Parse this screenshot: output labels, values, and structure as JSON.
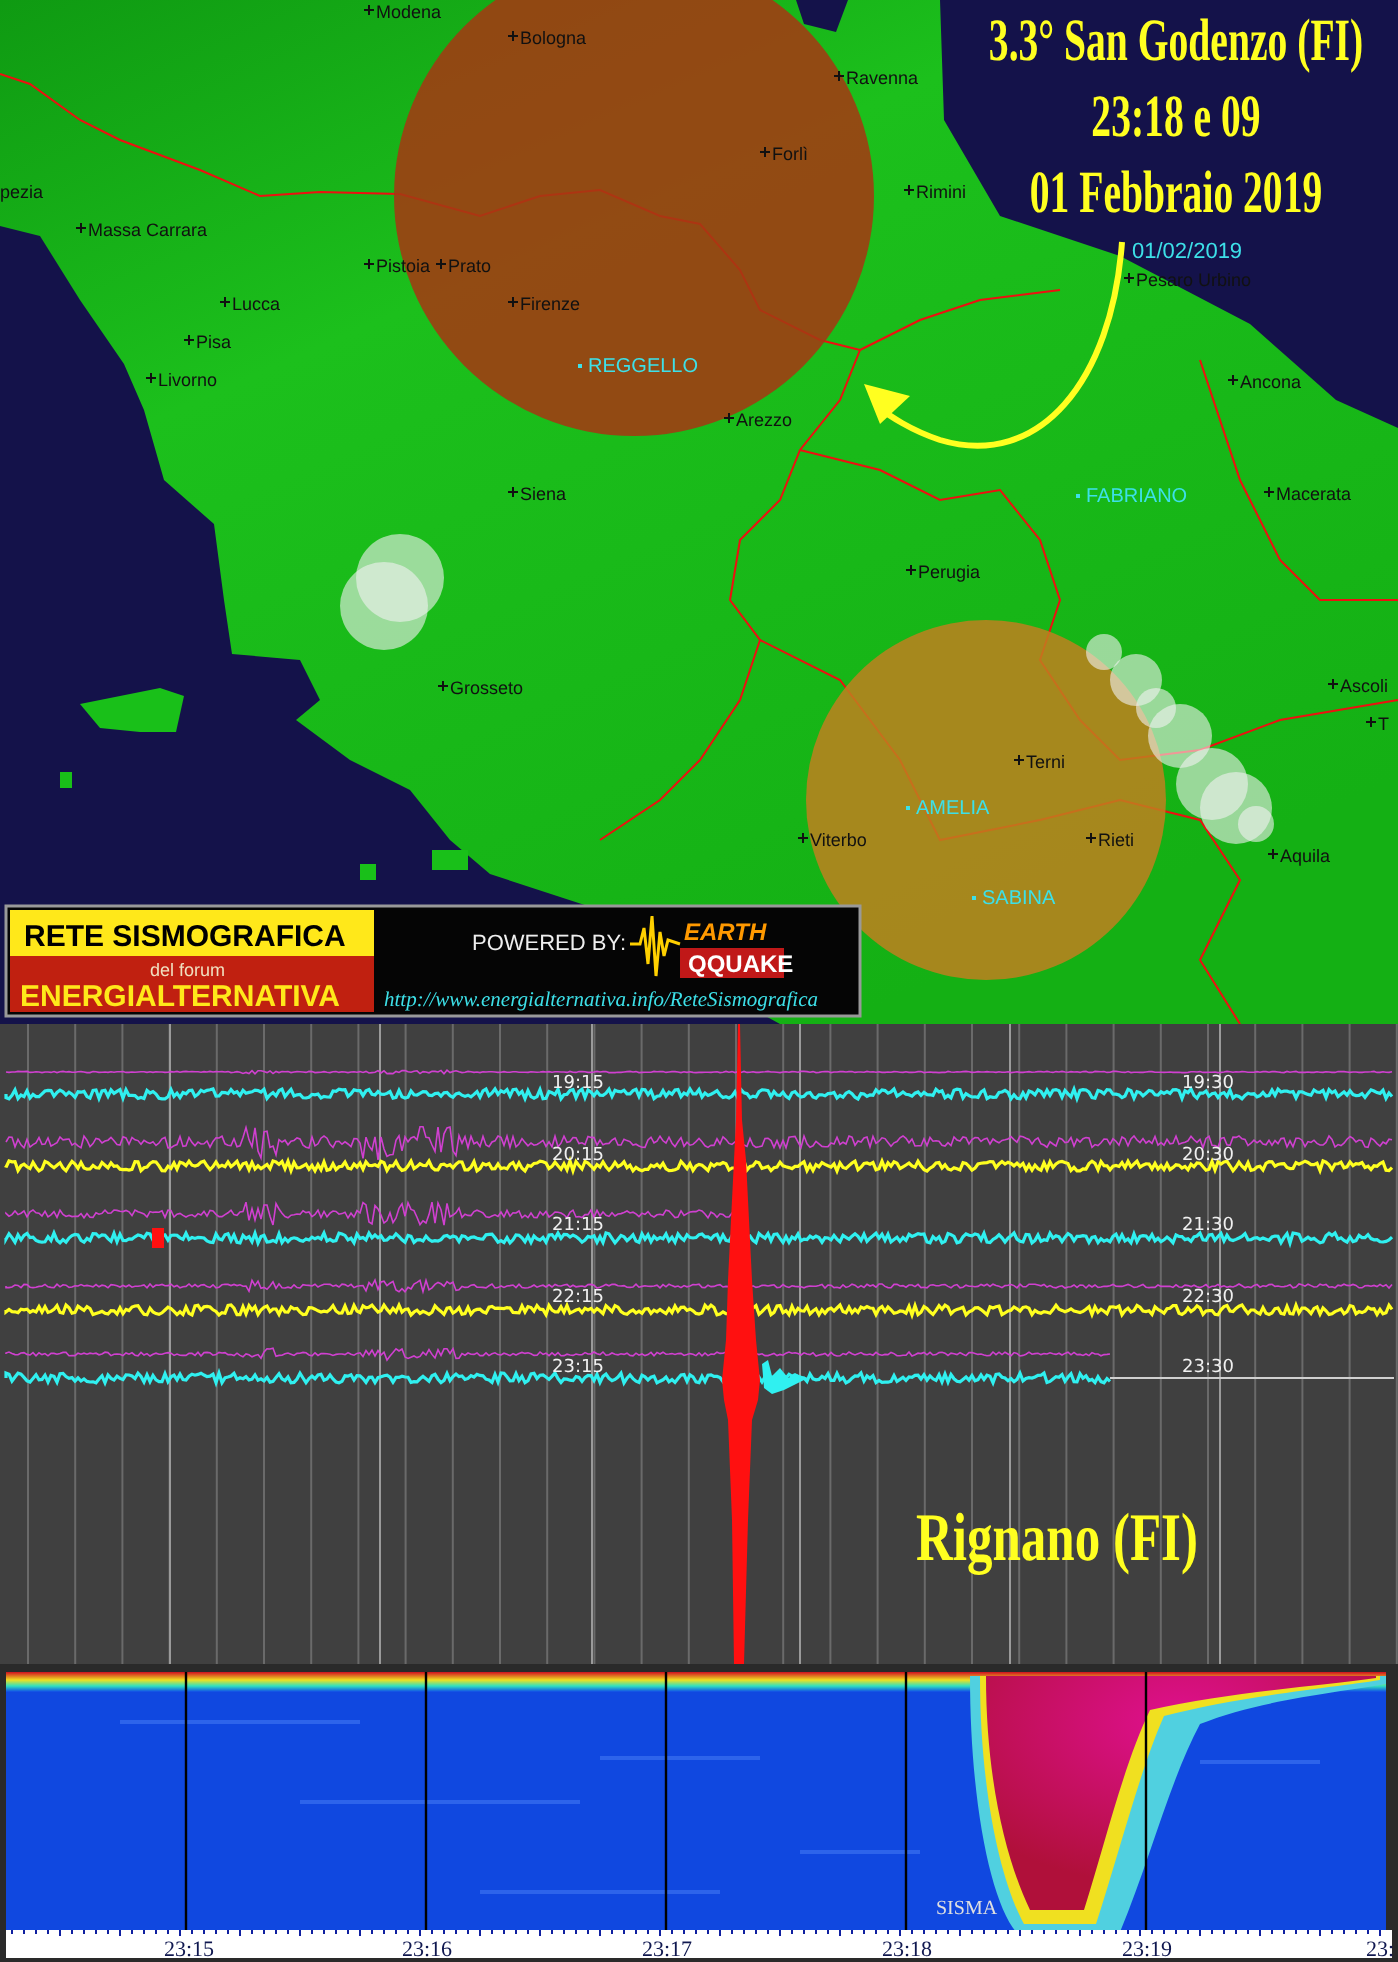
{
  "map": {
    "headline": [
      "3.3° San Godenzo (FI)",
      "23:18 e 09",
      "01 Febbraio 2019"
    ],
    "date_label": "01/02/2019",
    "cities": [
      {
        "name": "Modena"
      },
      {
        "name": "Bologna"
      },
      {
        "name": "Ravenna"
      },
      {
        "name": "Forlì"
      },
      {
        "name": "Rimini"
      },
      {
        "name": "Pesaro Urbino"
      },
      {
        "name": "pezia"
      },
      {
        "name": "Massa Carrara"
      },
      {
        "name": "Pistoia"
      },
      {
        "name": "Prato"
      },
      {
        "name": "Firenze"
      },
      {
        "name": "Lucca"
      },
      {
        "name": "Pisa"
      },
      {
        "name": "Livorno"
      },
      {
        "name": "Siena"
      },
      {
        "name": "Arezzo"
      },
      {
        "name": "Ancona"
      },
      {
        "name": "Macerata"
      },
      {
        "name": "Perugia"
      },
      {
        "name": "Grosseto"
      },
      {
        "name": "Terni"
      },
      {
        "name": "Viterbo"
      },
      {
        "name": "Rieti"
      },
      {
        "name": "Ascoli"
      },
      {
        "name": "T"
      },
      {
        "name": "Aquila"
      }
    ],
    "stations": [
      {
        "name": "REGGELLO"
      },
      {
        "name": "FABRIANO"
      },
      {
        "name": "AMELIA"
      },
      {
        "name": "SABINA"
      }
    ],
    "banner": {
      "title": "RETE SISMOGRAFICA",
      "subtitle": "del forum",
      "forum_name": "ENERGIALTERNATIVA",
      "powered_by": "POWERED BY:",
      "logo_top": "EARTH",
      "logo_bottom": "QQUAKE",
      "url": "http://www.energialternativa.info/ReteSismografica"
    }
  },
  "seismogram": {
    "time_labels": [
      "19:15",
      "19:30",
      "20:15",
      "20:30",
      "21:15",
      "21:30",
      "22:15",
      "22:30",
      "23:15",
      "23:30"
    ],
    "station_label": "Rignano (FI)"
  },
  "spectrogram": {
    "marker_label": "SISMA",
    "time_ticks": [
      "23:15",
      "23:16",
      "23:17",
      "23:18",
      "23:19",
      "23:"
    ]
  }
}
